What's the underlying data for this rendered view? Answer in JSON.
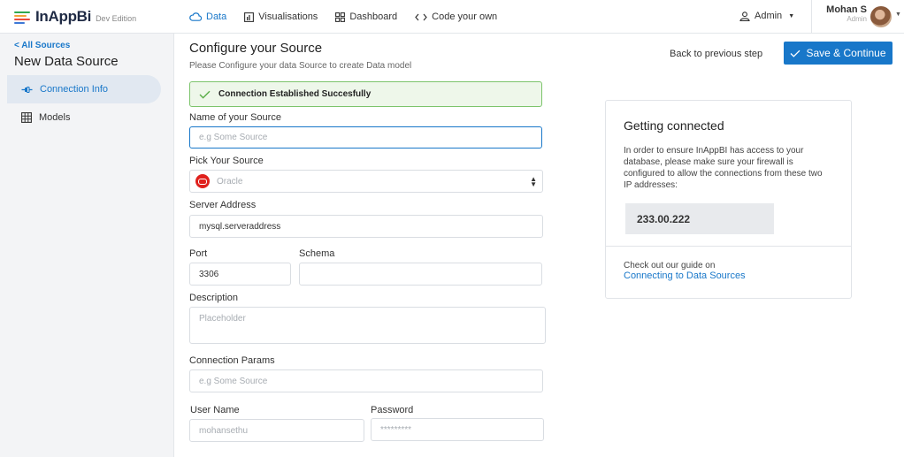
{
  "brand": {
    "name": "InAppBi",
    "edition": "Dev Edition",
    "stripe_colors": [
      "#2fa84f",
      "#f2a33a",
      "#e94b3c",
      "#3e78d6"
    ]
  },
  "nav": {
    "tabs": [
      {
        "label": "Data",
        "icon": "cloud-icon",
        "active": true
      },
      {
        "label": "Visualisations",
        "icon": "bar-chart-icon",
        "active": false
      },
      {
        "label": "Dashboard",
        "icon": "dashboard-grid-icon",
        "active": false
      },
      {
        "label": "Code your own",
        "icon": "code-icon",
        "active": false
      }
    ],
    "admin_label": "Admin",
    "user_name": "Mohan S",
    "user_role": "Admin"
  },
  "sidebar": {
    "back_label": "< All Sources",
    "title": "New Data Source",
    "items": [
      {
        "label": "Connection Info",
        "icon": "plug-icon",
        "active": true
      },
      {
        "label": "Models",
        "icon": "table-grid-icon",
        "active": false
      }
    ]
  },
  "main": {
    "title": "Configure your Source",
    "subtitle": "Please Configure your data Source to create Data model",
    "alert": "Connection Established Succesfully",
    "fields": {
      "source_name": {
        "label": "Name of your Source",
        "placeholder": "e.g Some Source"
      },
      "pick_source": {
        "label": "Pick Your Source",
        "value": "Oracle"
      },
      "server_address": {
        "label": "Server Address",
        "value": "mysql.serveraddress"
      },
      "port": {
        "label": "Port",
        "value": "3306"
      },
      "schema": {
        "label": "Schema",
        "value": ""
      },
      "description": {
        "label": "Description",
        "placeholder": "Placeholder"
      },
      "connection_params": {
        "label": "Connection Params",
        "placeholder": "e.g Some Source"
      },
      "user_name": {
        "label": "User Name",
        "placeholder": "mohansethu"
      },
      "password": {
        "label": "Password",
        "placeholder": "*********"
      }
    }
  },
  "actions": {
    "back_step": "Back to previous step",
    "save": "Save & Continue"
  },
  "info_card": {
    "title": "Getting connected",
    "body": "In order to ensure InAppBI has access to your database, please make sure your firewall is configured to allow the connections from these two IP addresses:",
    "ip": "233.00.222",
    "guide_text": "Check out our guide on",
    "guide_link": "Connecting to Data Sources"
  },
  "colors": {
    "accent": "#1877c9",
    "success_border": "#7cc46b",
    "success_bg": "#eef7ea",
    "oracle_red": "#e0211d"
  }
}
